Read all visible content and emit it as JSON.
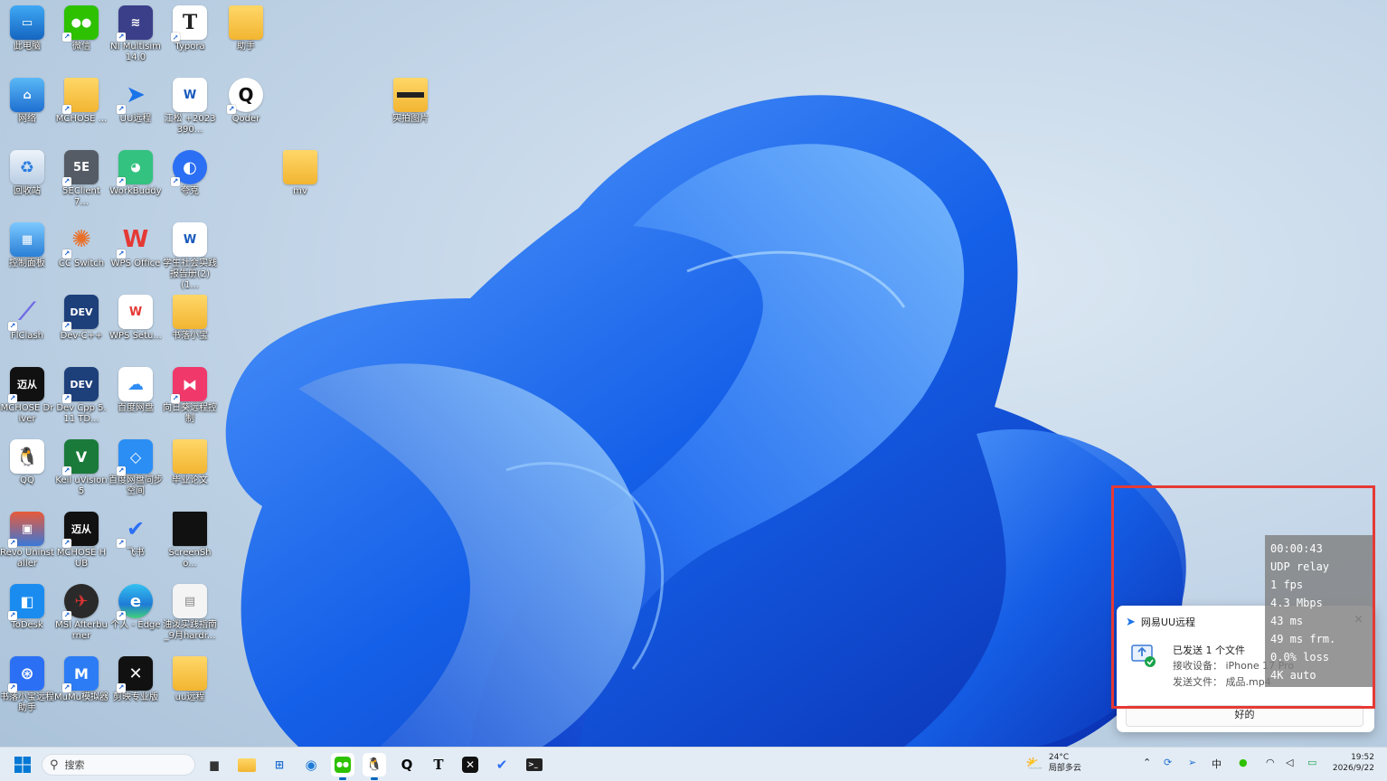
{
  "desktop": {
    "icons": [
      {
        "label": "此电脑"
      },
      {
        "label": "微信"
      },
      {
        "label": "NI Multisim 14.0"
      },
      {
        "label": "Typora"
      },
      {
        "label": "助手"
      },
      {
        "label": "网络"
      },
      {
        "label": "MCHOSE ..."
      },
      {
        "label": "UU远程"
      },
      {
        "label": "江松 +2023390..."
      },
      {
        "label": "Qoder"
      },
      {
        "label": "实拍图片"
      },
      {
        "label": "回收站"
      },
      {
        "label": "5EClient 7..."
      },
      {
        "label": "WorkBuddy"
      },
      {
        "label": "夸克"
      },
      {
        "label": "mv"
      },
      {
        "label": "控制面板"
      },
      {
        "label": "CC Switch"
      },
      {
        "label": "WPS Office"
      },
      {
        "label": "学生社会实践报告册(2)(1..."
      },
      {
        "label": "FlClash"
      },
      {
        "label": "Dev-C++"
      },
      {
        "label": "WPS Setu..."
      },
      {
        "label": "书落小宝"
      },
      {
        "label": "MCHOSE Driver"
      },
      {
        "label": "Dev Cpp 5.11 TD..."
      },
      {
        "label": "百度网盘"
      },
      {
        "label": "向日葵远程控制"
      },
      {
        "label": "QQ"
      },
      {
        "label": "Keil uVision5"
      },
      {
        "label": "百度网盘同步空间"
      },
      {
        "label": "毕业论文"
      },
      {
        "label": "Revo Uninstaller"
      },
      {
        "label": "MCHOSE HUB"
      },
      {
        "label": "飞书"
      },
      {
        "label": "ScreenSho..."
      },
      {
        "label": "ToDesk"
      },
      {
        "label": "MSI Afterburner"
      },
      {
        "label": "个人 - Edge"
      },
      {
        "label": "油泼实践指南_9月hardr..."
      },
      {
        "label": "书落小宝远程助手"
      },
      {
        "label": "MuMu模拟器"
      },
      {
        "label": "剪映专业版"
      },
      {
        "label": "uu远程"
      }
    ]
  },
  "notification": {
    "app_name": "网易UU远程",
    "title": "已发送 1 个文件",
    "device_line": "接收设备： iPhone 17 Pro",
    "file_line": "发送文件： 成品.mp4",
    "ok_label": "好的",
    "close_glyph": "×"
  },
  "stats_overlay": {
    "lines": [
      "00:00:43",
      "UDP relay",
      "1 fps",
      "4.3 Mbps",
      "43 ms",
      "49 ms frm.",
      "0.0% loss",
      "4K auto"
    ]
  },
  "taskbar": {
    "search_placeholder": "搜索",
    "weather_temp": "24°C",
    "weather_desc": "局部多云",
    "ime": "中",
    "time": "19:52",
    "date": "2026/9/22"
  }
}
